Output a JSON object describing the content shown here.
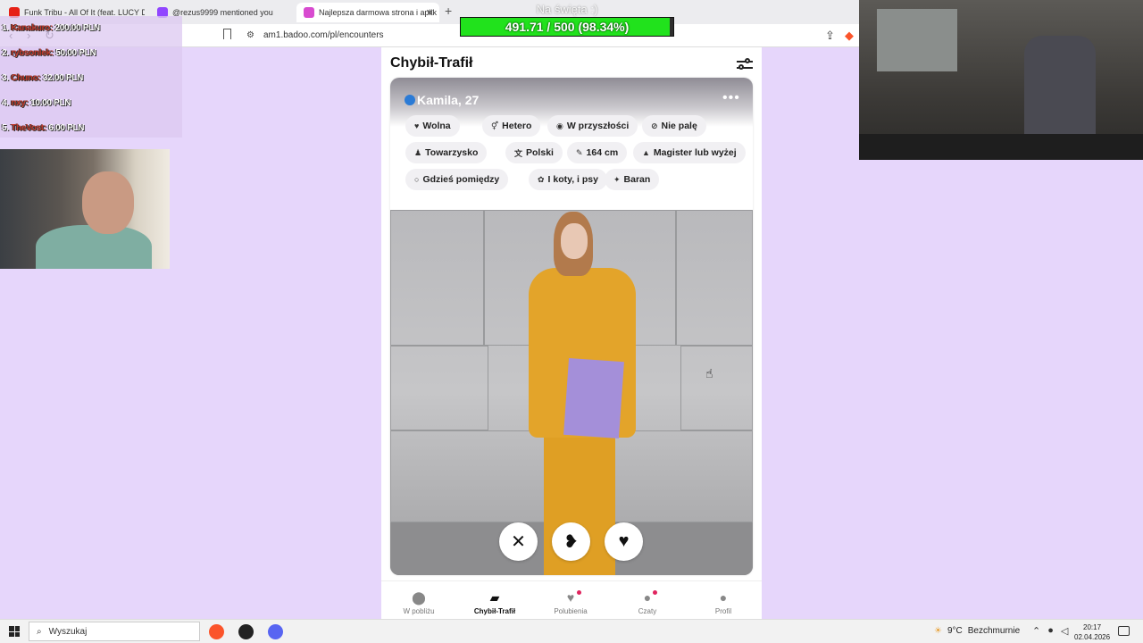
{
  "browser": {
    "tabs": [
      {
        "title": "Funk Tribu - All Of It (feat. LUCY DYE)"
      },
      {
        "title": "@rezus9999 mentioned you"
      },
      {
        "title": "Najlepsza darmowa strona i aplik"
      }
    ],
    "new_tab": "+",
    "url": "am1.badoo.com/pl/encounters"
  },
  "overlay": {
    "goal_title": "Na święta :)",
    "goal_text": "491.71 / 500 (98.34%)",
    "goal_progress": 0.9834,
    "goal_color": "#21e21c",
    "donors": [
      {
        "rank": "1.",
        "name": "Kanakuro:",
        "amount": "200.00 PLN"
      },
      {
        "rank": "2.",
        "name": "rybsonlek:",
        "amount": "50.00 PLN"
      },
      {
        "rank": "3.",
        "name": "Chuno:",
        "amount": "32.00 PLN"
      },
      {
        "rank": "4.",
        "name": "nxy:",
        "amount": "10.00 PLN"
      },
      {
        "rank": "5.",
        "name": "TheVost:",
        "amount": "6.00 PLN"
      }
    ]
  },
  "app": {
    "title": "Chybił-Trafił",
    "filter_icon": "sliders-icon",
    "profile": {
      "name": "Kamila, 27",
      "verified": true,
      "menu_icon": "more-dots-icon",
      "chips": [
        {
          "icon": "heart-icon",
          "label": "Wolna"
        },
        {
          "icon": "gender-icon",
          "label": "Hetero"
        },
        {
          "icon": "eye-icon",
          "label": "W przyszłości"
        },
        {
          "icon": "no-smoking-icon",
          "label": "Nie palę"
        },
        {
          "icon": "drink-icon",
          "label": "Towarzysko"
        },
        {
          "icon": "language-icon",
          "label": "Polski"
        },
        {
          "icon": "ruler-icon",
          "label": "164 cm"
        },
        {
          "icon": "graduation-cap-icon",
          "label": "Magister lub wyżej"
        },
        {
          "icon": "speech-bubble-icon",
          "label": "Gdzieś pomiędzy"
        },
        {
          "icon": "paw-icon",
          "label": "I koty, i psy"
        },
        {
          "icon": "zodiac-icon",
          "label": "Baran"
        }
      ]
    },
    "actions": [
      {
        "icon": "close-icon",
        "glyph": "✕"
      },
      {
        "icon": "crush-icon",
        "glyph": "❥"
      },
      {
        "icon": "like-icon",
        "glyph": "♥"
      }
    ],
    "bottom_nav": [
      {
        "icon": "location-pin-icon",
        "glyph": "⬤",
        "label": "W pobliżu",
        "active": false
      },
      {
        "icon": "cards-icon",
        "glyph": "▰",
        "label": "Chybił-Trafił",
        "active": true
      },
      {
        "icon": "heart-icon",
        "glyph": "♥",
        "label": "Polubienia",
        "active": false
      },
      {
        "icon": "chat-icon",
        "glyph": "●",
        "label": "Czaty",
        "active": false
      },
      {
        "icon": "profile-icon",
        "glyph": "●",
        "label": "Profil",
        "active": false
      }
    ]
  },
  "taskbar": {
    "search_placeholder": "Wyszukaj",
    "weather": "9°C",
    "weather_desc": "Bezchmurnie",
    "time": "20:17",
    "date": "02.04.2026"
  }
}
